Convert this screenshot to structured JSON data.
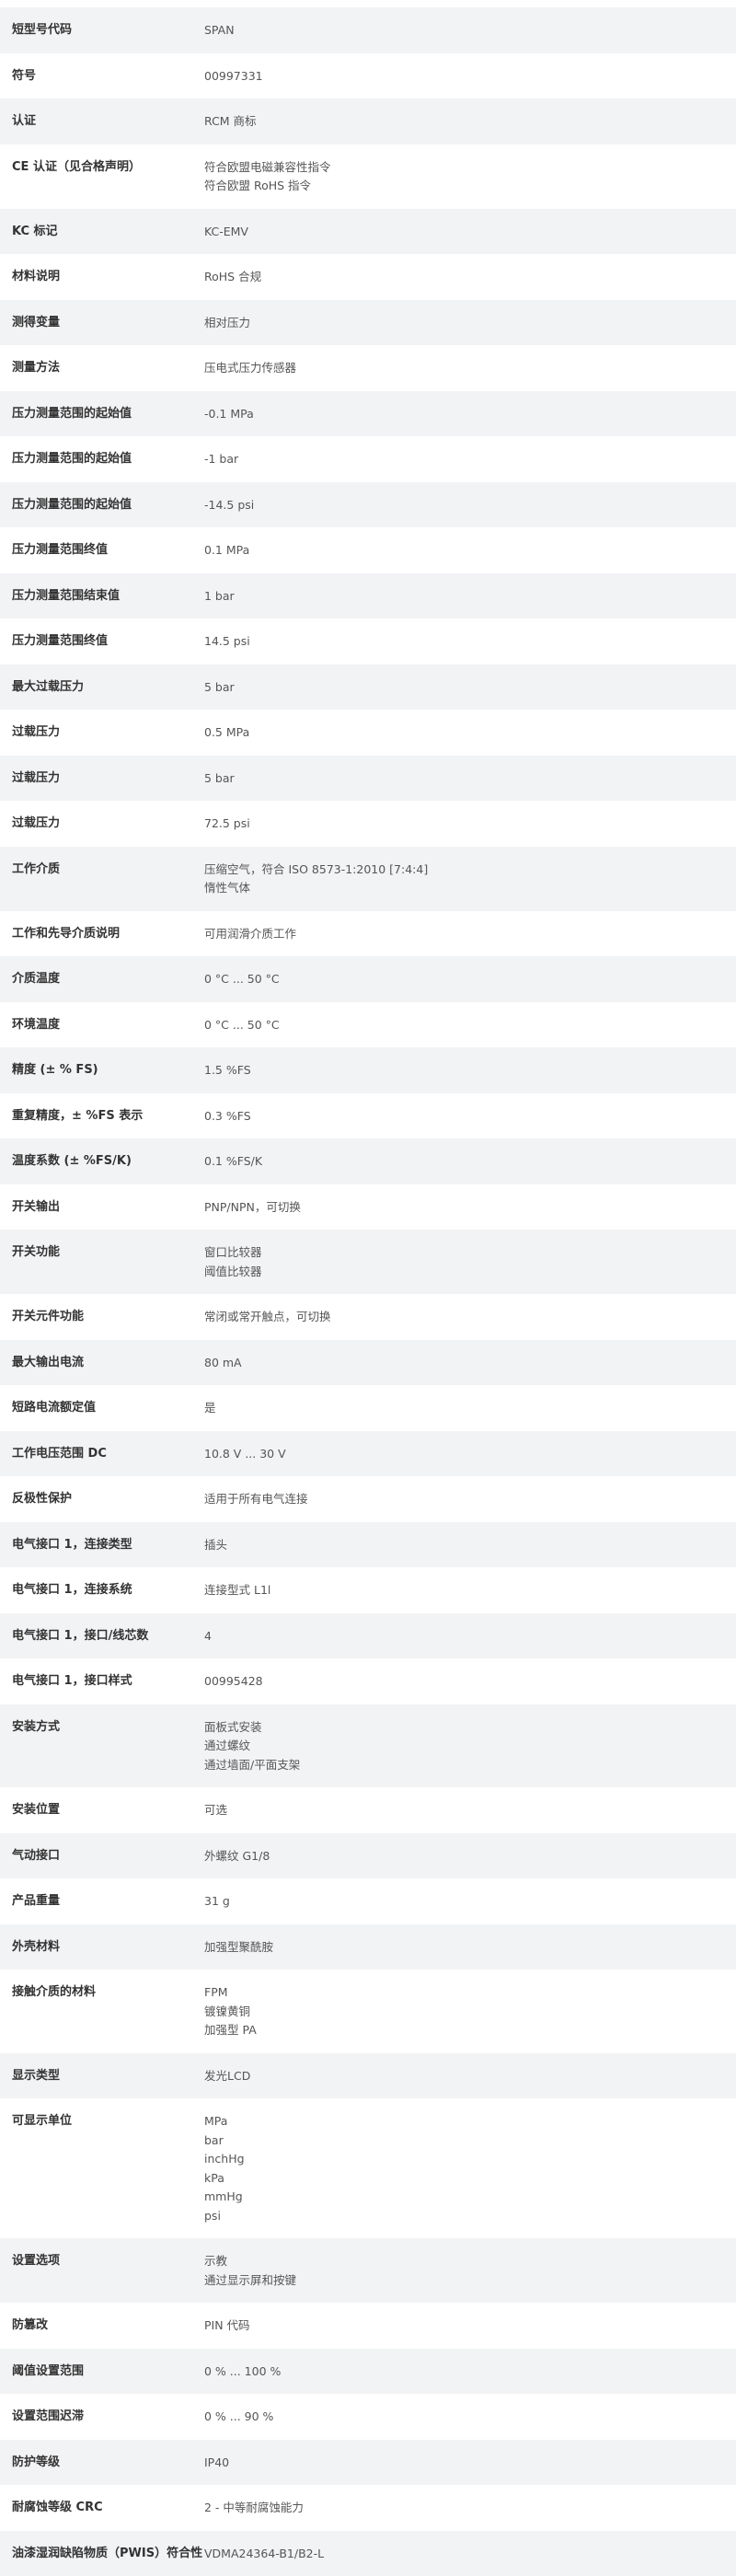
{
  "rows": [
    {
      "label": "短型号代码",
      "values": [
        "SPAN"
      ]
    },
    {
      "label": "符号",
      "values": [
        "00997331"
      ]
    },
    {
      "label": "认证",
      "values": [
        "RCM 商标"
      ]
    },
    {
      "label": "CE 认证（见合格声明）",
      "values": [
        "符合欧盟电磁兼容性指令",
        "符合欧盟 RoHS 指令"
      ]
    },
    {
      "label": "KC 标记",
      "values": [
        "KC-EMV"
      ]
    },
    {
      "label": "材料说明",
      "values": [
        "RoHS 合规"
      ]
    },
    {
      "label": "测得变量",
      "values": [
        "相对压力"
      ]
    },
    {
      "label": "测量方法",
      "values": [
        "压电式压力传感器"
      ]
    },
    {
      "label": "压力测量范围的起始值",
      "values": [
        "-0.1 MPa"
      ]
    },
    {
      "label": "压力测量范围的起始值",
      "values": [
        "-1 bar"
      ]
    },
    {
      "label": "压力测量范围的起始值",
      "values": [
        "-14.5 psi"
      ]
    },
    {
      "label": "压力测量范围终值",
      "values": [
        "0.1 MPa"
      ]
    },
    {
      "label": "压力测量范围结束值",
      "values": [
        "1 bar"
      ]
    },
    {
      "label": "压力测量范围终值",
      "values": [
        "14.5 psi"
      ]
    },
    {
      "label": "最大过载压力",
      "values": [
        "5 bar"
      ]
    },
    {
      "label": "过载压力",
      "values": [
        "0.5 MPa"
      ]
    },
    {
      "label": "过载压力",
      "values": [
        "5 bar"
      ]
    },
    {
      "label": "过载压力",
      "values": [
        "72.5 psi"
      ]
    },
    {
      "label": "工作介质",
      "values": [
        "压缩空气，符合 ISO 8573-1:2010 [7:4:4]",
        "惰性气体"
      ]
    },
    {
      "label": "工作和先导介质说明",
      "values": [
        "可用润滑介质工作"
      ]
    },
    {
      "label": "介质温度",
      "values": [
        "0 °C ... 50 °C"
      ]
    },
    {
      "label": "环境温度",
      "values": [
        "0 °C ... 50 °C"
      ]
    },
    {
      "label": "精度 (± % FS)",
      "values": [
        "1.5 %FS"
      ]
    },
    {
      "label": "重复精度，± %FS 表示",
      "values": [
        "0.3 %FS"
      ]
    },
    {
      "label": "温度系数 (± %FS/K)",
      "values": [
        "0.1 %FS/K"
      ]
    },
    {
      "label": "开关输出",
      "values": [
        "PNP/NPN，可切换"
      ]
    },
    {
      "label": "开关功能",
      "values": [
        "窗口比较器",
        "阈值比较器"
      ]
    },
    {
      "label": "开关元件功能",
      "values": [
        "常闭或常开触点，可切换"
      ]
    },
    {
      "label": "最大输出电流",
      "values": [
        "80 mA"
      ]
    },
    {
      "label": "短路电流额定值",
      "values": [
        "是"
      ]
    },
    {
      "label": "工作电压范围 DC",
      "values": [
        "10.8 V ... 30 V"
      ]
    },
    {
      "label": "反极性保护",
      "values": [
        "适用于所有电气连接"
      ]
    },
    {
      "label": "电气接口 1，连接类型",
      "values": [
        "插头"
      ]
    },
    {
      "label": "电气接口 1，连接系统",
      "values": [
        "连接型式 L1l"
      ]
    },
    {
      "label": "电气接口 1，接口/线芯数",
      "values": [
        "4"
      ]
    },
    {
      "label": "电气接口 1，接口样式",
      "values": [
        "00995428"
      ]
    },
    {
      "label": "安装方式",
      "values": [
        "面板式安装",
        "通过螺纹",
        "通过墙面/平面支架"
      ]
    },
    {
      "label": "安装位置",
      "values": [
        "可选"
      ]
    },
    {
      "label": "气动接口",
      "values": [
        "外螺纹 G1/8"
      ]
    },
    {
      "label": "产品重量",
      "values": [
        "31 g"
      ]
    },
    {
      "label": "外壳材料",
      "values": [
        "加强型聚酰胺"
      ]
    },
    {
      "label": "接触介质的材料",
      "values": [
        "FPM",
        "镀镍黄铜",
        "加强型 PA"
      ]
    },
    {
      "label": "显示类型",
      "values": [
        "发光LCD"
      ]
    },
    {
      "label": "可显示单位",
      "values": [
        "MPa",
        "bar",
        "inchHg",
        "kPa",
        "mmHg",
        "psi"
      ]
    },
    {
      "label": "设置选项",
      "values": [
        "示教",
        "通过显示屏和按键"
      ]
    },
    {
      "label": "防篡改",
      "values": [
        "PIN 代码"
      ]
    },
    {
      "label": "阈值设置范围",
      "values": [
        "0 % ... 100 %"
      ]
    },
    {
      "label": "设置范围迟滞",
      "values": [
        "0 % ... 90 %"
      ]
    },
    {
      "label": "防护等级",
      "values": [
        "IP40"
      ]
    },
    {
      "label": "耐腐蚀等级 CRC",
      "values": [
        "2 - 中等耐腐蚀能力"
      ]
    },
    {
      "label": "油漆湿润缺陷物质（PWIS）符合性",
      "values": [
        "VDMA24364-B1/B2-L"
      ]
    }
  ]
}
